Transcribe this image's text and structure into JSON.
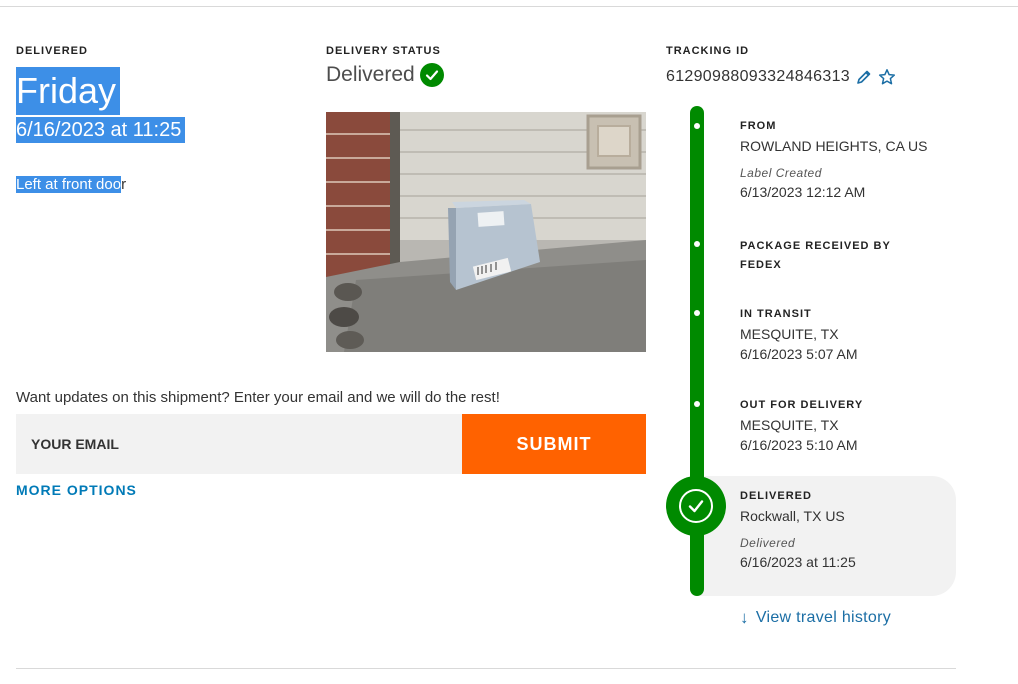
{
  "delivered_section": {
    "eyebrow": "DELIVERED",
    "day": "Friday",
    "date_time": "6/16/2023 at 11:25",
    "left_at_selected": "Left at front doo",
    "left_at_rest": "r"
  },
  "status_section": {
    "eyebrow": "DELIVERY STATUS",
    "status": "Delivered",
    "status_icon": "check-circle-icon",
    "photo_alt": "package-at-front-door-photo"
  },
  "tracking_section": {
    "eyebrow": "TRACKING ID",
    "tracking_id": "612909880933248463 13",
    "tracking_id_display": "612909880933248463 13",
    "edit_icon": "pencil-icon",
    "favorite_icon": "star-icon"
  },
  "email_form": {
    "prompt": "Want updates on this shipment? Enter your email and we will do the rest!",
    "placeholder": "YOUR EMAIL",
    "submit_label": "SUBMIT",
    "more_options_label": "MORE OPTIONS"
  },
  "timeline": {
    "steps": [
      {
        "title": "FROM",
        "line1": "ROWLAND HEIGHTS, CA US",
        "sub": "Label Created",
        "line2": "6/13/2023 12:12 AM"
      },
      {
        "title": "PACKAGE RECEIVED BY",
        "title2": "FEDEX"
      },
      {
        "title": "IN TRANSIT",
        "line1": "MESQUITE, TX",
        "line2": "6/16/2023 5:07 AM"
      },
      {
        "title": "OUT FOR DELIVERY",
        "line1": "MESQUITE, TX",
        "line2": "6/16/2023 5:10 AM"
      },
      {
        "title": "DELIVERED",
        "line1": "Rockwall, TX US",
        "sub": "Delivered",
        "line2": "6/16/2023 at 11:25"
      }
    ],
    "view_history_label": "View travel history"
  },
  "colors": {
    "fedex_green": "#008a00",
    "fedex_orange": "#ff6200",
    "link_blue": "#007ab7",
    "selection_blue": "#3d8fe7"
  }
}
